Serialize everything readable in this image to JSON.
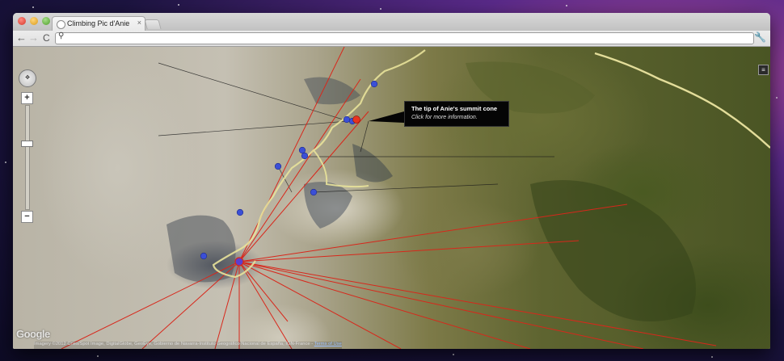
{
  "browser": {
    "tab_title": "Climbing Pic d'Anie",
    "tab_close": "×",
    "address_value": "",
    "search_icon": "⚲",
    "back_icon": "←",
    "forward_icon": "→",
    "reload_icon": "C",
    "wrench_icon": "🔧"
  },
  "map": {
    "zoom_in_label": "+",
    "zoom_out_label": "−",
    "pan_label": "✥",
    "layer_icon": "≡",
    "google_logo": "Google",
    "attribution": "Imagery ©2012 Cnes/Spot Image, DigitalGlobe, GeoEye, Gobierno de Navarra-Instituto Geográfico Nacional de España, IGN-France - ",
    "terms_link": "Terms of Use"
  },
  "callout": {
    "title": "The tip of Anie's summit cone",
    "subtitle": "Click for more information."
  },
  "colors": {
    "route": "#e8e29a",
    "sightline": "#d8271b",
    "marker": "#3b4fd6",
    "summit_marker": "#e8331f"
  }
}
